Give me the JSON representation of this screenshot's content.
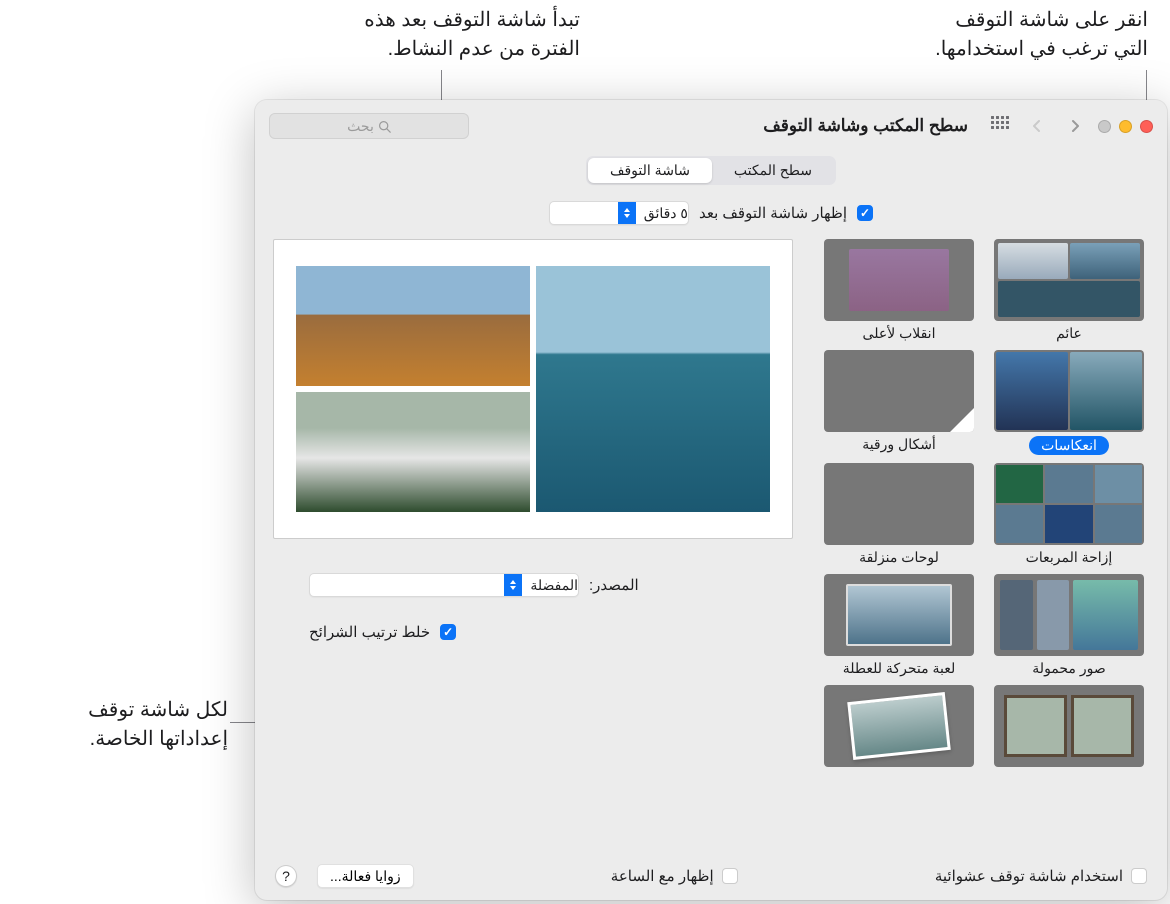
{
  "callouts": {
    "select": "انقر على شاشة التوقف\nالتي ترغب في استخدامها.",
    "timer": "تبدأ شاشة التوقف بعد هذه\nالفترة من عدم النشاط.",
    "settings": "لكل شاشة توقف\nإعداداتها الخاصة."
  },
  "window": {
    "title": "سطح المكتب وشاشة التوقف",
    "search_placeholder": "بحث",
    "tabs": {
      "desktop": "سطح المكتب",
      "screensaver": "شاشة التوقف"
    },
    "show_after_label": "إظهار شاشة التوقف بعد",
    "popup_delay": "٥ دقائق",
    "source_label": "المصدر:",
    "source_value": "المفضلة",
    "shuffle_label": "خلط ترتيب الشرائح",
    "random_label": "استخدام شاشة توقف عشوائية",
    "clock_label": "إظهار مع الساعة",
    "hot_corners": "زوايا فعالة...",
    "thumbs": [
      {
        "key": "floating",
        "label": "عائم"
      },
      {
        "key": "flipup",
        "label": "انقلاب لأعلى"
      },
      {
        "key": "reflections",
        "label": "انعكاسات"
      },
      {
        "key": "origami",
        "label": "أشكال ورقية"
      },
      {
        "key": "shifting",
        "label": "إزاحة المربعات"
      },
      {
        "key": "sliding",
        "label": "لوحات منزلقة"
      },
      {
        "key": "mobile",
        "label": "صور محمولة"
      },
      {
        "key": "holiday",
        "label": "لعبة متحركة للعطلة"
      }
    ]
  }
}
